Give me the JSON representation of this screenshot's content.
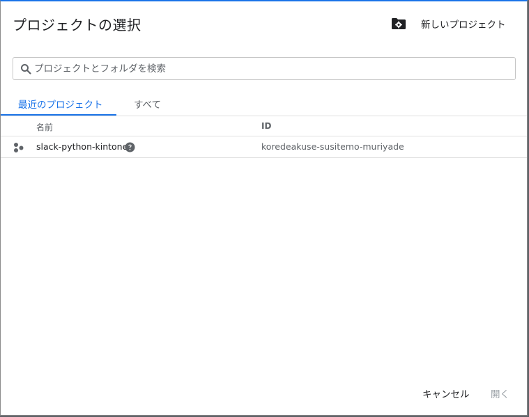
{
  "dialog": {
    "title": "プロジェクトの選択",
    "new_project_label": "新しいプロジェクト"
  },
  "search": {
    "placeholder": "プロジェクトとフォルダを検索",
    "value": ""
  },
  "tabs": [
    {
      "label": "最近のプロジェクト",
      "active": true
    },
    {
      "label": "すべて",
      "active": false
    }
  ],
  "table": {
    "columns": [
      "名前",
      "ID"
    ],
    "rows": [
      {
        "name": "slack-python-kintone",
        "id": "koredeakuse-susitemo-muriyade"
      }
    ]
  },
  "footer": {
    "cancel_label": "キャンセル",
    "open_label": "開く"
  },
  "colors": {
    "accent": "#1a73e8",
    "text": "#202124",
    "muted": "#5f6368",
    "disabled": "#9aa0a6",
    "divider": "#e0e0e0"
  },
  "icons": {
    "new_project": "folder-gear-icon",
    "search": "search-icon",
    "project": "project-dots-icon",
    "help": "help-circle-icon"
  }
}
